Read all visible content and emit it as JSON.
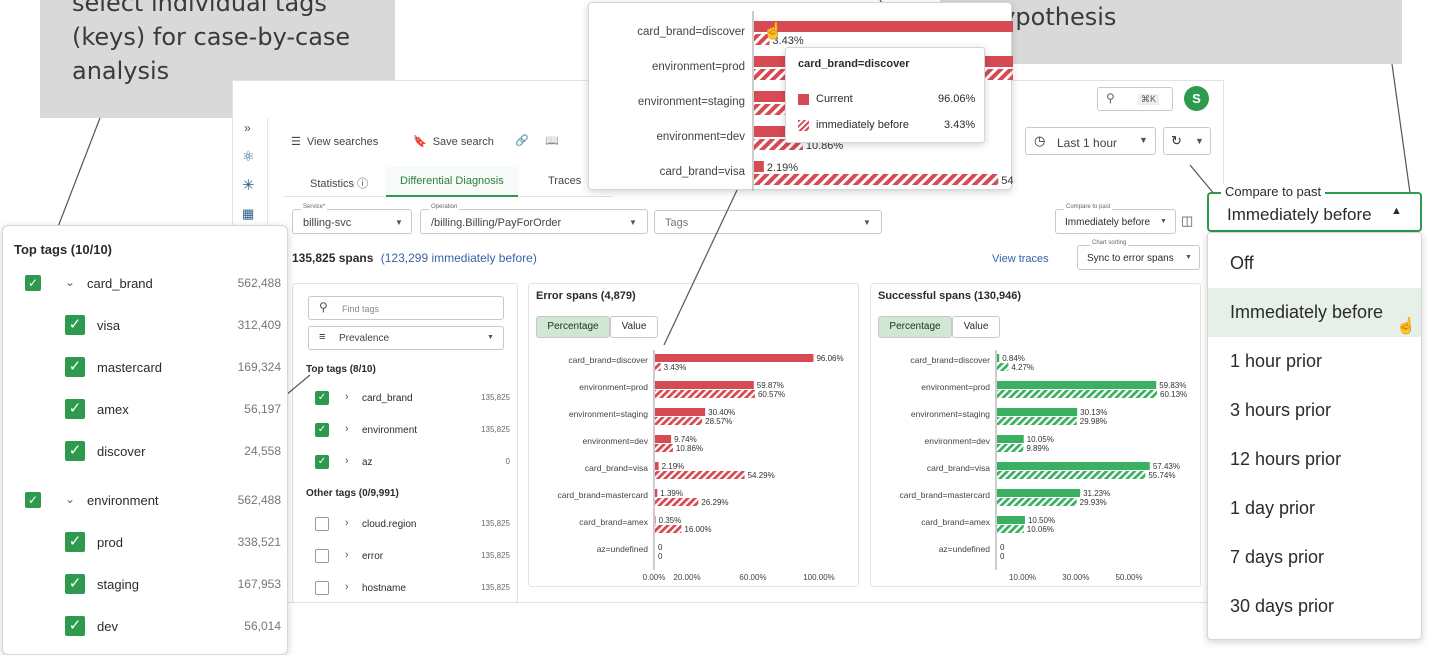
{
  "callouts": {
    "left": [
      "select individual tags",
      "(keys) for case-by-case",
      "analysis"
    ],
    "right": "hypothesis"
  },
  "top_bar": {
    "search_shortcut": "⌘K",
    "avatar": "S"
  },
  "toolbar": {
    "view_searches": "View searches",
    "save_search": "Save search",
    "time_range": "Last 1 hour"
  },
  "tabs": [
    "Statistics",
    "Differential Diagnosis",
    "Traces"
  ],
  "filters": {
    "service_label": "Service*",
    "service_value": "billing-svc",
    "operation_label": "Operation",
    "operation_value": "/billing.Billing/PayForOrder",
    "tags_placeholder": "Tags",
    "compare_label": "Compare to past",
    "compare_value": "Immediately before"
  },
  "summary": {
    "spans": "135,825 spans",
    "before": "(123,299 immediately before)",
    "view_traces": "View traces",
    "sorting_label": "Chart sorting",
    "sorting_value": "Sync to error spans"
  },
  "tag_panel": {
    "search_placeholder": "Find tags",
    "sort_value": "Prevalence",
    "top_header": "Top tags (8/10)",
    "top_tags": [
      {
        "name": "card_brand",
        "count": "135,825"
      },
      {
        "name": "environment",
        "count": "135,825"
      },
      {
        "name": "az",
        "count": "0"
      }
    ],
    "other_header": "Other tags (0/9,991)",
    "other_tags": [
      {
        "name": "cloud.region",
        "count": "135,825"
      },
      {
        "name": "error",
        "count": "135,825"
      },
      {
        "name": "hostname",
        "count": "135,825"
      }
    ]
  },
  "zoom_panel": {
    "header": "Top tags (10/10)",
    "groups": [
      {
        "name": "card_brand",
        "count": "562,488",
        "children": [
          {
            "name": "visa",
            "count": "312,409"
          },
          {
            "name": "mastercard",
            "count": "169,324"
          },
          {
            "name": "amex",
            "count": "56,197"
          },
          {
            "name": "discover",
            "count": "24,558"
          }
        ]
      },
      {
        "name": "environment",
        "count": "562,488",
        "children": [
          {
            "name": "prod",
            "count": "338,521"
          },
          {
            "name": "staging",
            "count": "167,953"
          },
          {
            "name": "dev",
            "count": "56,014"
          }
        ]
      }
    ]
  },
  "seg": {
    "percentage": "Percentage",
    "value": "Value"
  },
  "chart_data": [
    {
      "type": "bar",
      "title": "Error spans (4,879)",
      "categories": [
        "card_brand=discover",
        "environment=prod",
        "environment=staging",
        "environment=dev",
        "card_brand=visa",
        "card_brand=mastercard",
        "card_brand=amex",
        "az=undefined"
      ],
      "series": [
        {
          "name": "Current",
          "values": [
            96.06,
            59.87,
            30.4,
            9.74,
            2.19,
            1.39,
            0.35,
            0
          ],
          "labels": [
            "96.06%",
            "59.87%",
            "30.40%",
            "9.74%",
            "2.19%",
            "1.39%",
            "0.35%",
            "0"
          ]
        },
        {
          "name": "immediately before",
          "values": [
            3.43,
            60.57,
            28.57,
            10.86,
            54.29,
            26.29,
            16.0,
            0
          ],
          "labels": [
            "3.43%",
            "60.57%",
            "28.57%",
            "10.86%",
            "54.29%",
            "26.29%",
            "16.00%",
            "0"
          ]
        }
      ],
      "xticks": [
        "0.00%",
        "20.00%",
        "60.00%",
        "100.00%"
      ],
      "xlim": [
        0,
        100
      ]
    },
    {
      "type": "bar",
      "title": "Successful spans (130,946)",
      "categories": [
        "card_brand=discover",
        "environment=prod",
        "environment=staging",
        "environment=dev",
        "card_brand=visa",
        "card_brand=mastercard",
        "card_brand=amex",
        "az=undefined"
      ],
      "series": [
        {
          "name": "Current",
          "values": [
            0.84,
            59.83,
            30.13,
            10.05,
            57.43,
            31.23,
            10.5,
            0
          ],
          "labels": [
            "0.84%",
            "59.83%",
            "30.13%",
            "10.05%",
            "57.43%",
            "31.23%",
            "10.50%",
            "0"
          ]
        },
        {
          "name": "immediately before",
          "values": [
            4.27,
            60.13,
            29.98,
            9.89,
            55.74,
            29.93,
            10.06,
            0
          ],
          "labels": [
            "4.27%",
            "60.13%",
            "29.98%",
            "9.89%",
            "55.74%",
            "29.93%",
            "10.06%",
            "0"
          ]
        }
      ],
      "xticks": [
        "10.00%",
        "30.00%",
        "50.00%"
      ],
      "xlim": [
        0,
        62
      ]
    }
  ],
  "zoom_chart": {
    "categories": [
      "card_brand=discover",
      "environment=prod",
      "environment=staging",
      "environment=dev",
      "card_brand=visa"
    ],
    "labels_before": [
      "3.43%",
      "",
      "",
      "10.86%",
      "54.29%"
    ],
    "labels_current": [
      "",
      "",
      "",
      "9.",
      "2.19%"
    ]
  },
  "tooltip": {
    "title": "card_brand=discover",
    "rows": [
      {
        "label": "Current",
        "value": "96.06%"
      },
      {
        "label": "immediately before",
        "value": "3.43%"
      }
    ]
  },
  "compare_dropdown": {
    "label": "Compare to past",
    "value": "Immediately before",
    "options": [
      "Off",
      "Immediately before",
      "1 hour prior",
      "3 hours prior",
      "12 hours prior",
      "1 day prior",
      "7 days prior",
      "30 days prior"
    ],
    "selected_index": 1
  },
  "colors": {
    "error": "#d64a54",
    "success": "#3bb063",
    "accent": "#2e9a4e"
  }
}
